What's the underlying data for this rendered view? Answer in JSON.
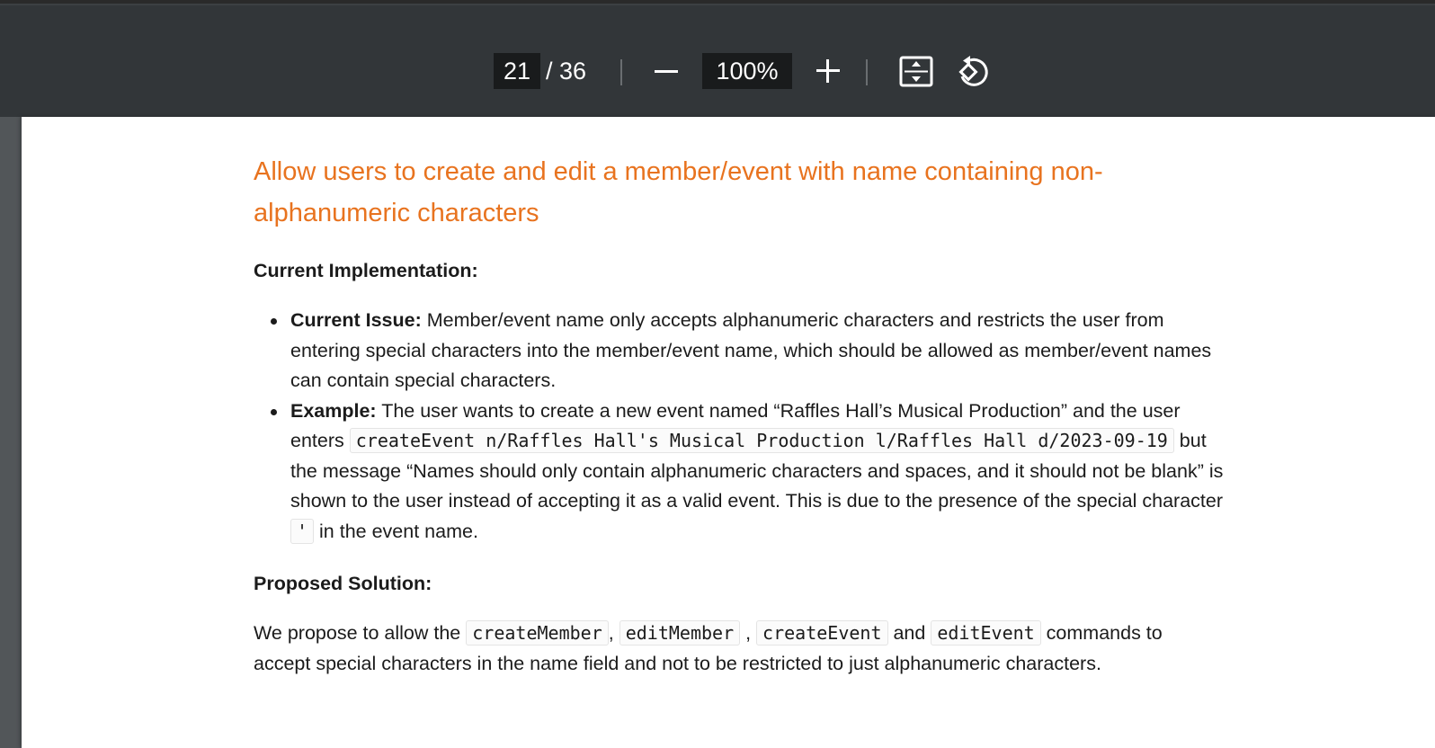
{
  "toolbar": {
    "page_current": "21",
    "page_total": "/ 36",
    "zoom_level": "100%",
    "icons": {
      "zoom_out": "minus-icon",
      "zoom_in": "plus-icon",
      "fit": "fit-to-page-icon",
      "rotate": "rotate-counterclockwise-icon"
    }
  },
  "document": {
    "title": "Allow users to create and edit a member/event with name containing non-alphanumeric characters",
    "current_heading": "Current Implementation:",
    "items": [
      {
        "label": "Current Issue:",
        "text": " Member/event name only accepts alphanumeric characters and restricts the user from entering special characters into the member/event name, which should be allowed as member/event names can contain special characters."
      },
      {
        "label": "Example:",
        "text_1": " The user wants to create a new event named “Raffles Hall’s Musical Production” and the user enters ",
        "code_1": "createEvent n/Raffles Hall's Musical Production l/Raffles Hall d/2023-09-19",
        "text_2": " but the message “Names should only contain alphanumeric characters and spaces, and it should not be blank” is shown to the user instead of accepting it as a valid event. This is due to the presence of the special character ",
        "code_2": "'",
        "text_3": " in the event name."
      }
    ],
    "proposed_heading": "Proposed Solution:",
    "proposal": {
      "text_1": "We propose to allow the ",
      "code_1": "createMember",
      "sep_1": ", ",
      "code_2": "editMember",
      "sep_2": " , ",
      "code_3": "createEvent",
      "sep_3": " and ",
      "code_4": "editEvent",
      "text_2": " commands to accept special characters in the name field and not to be restricted to just alphanumeric characters."
    }
  },
  "colors": {
    "toolbar_bg": "#323639",
    "viewer_bg": "#525659",
    "heading_accent": "#e8731f",
    "text": "#1b1b1b"
  }
}
